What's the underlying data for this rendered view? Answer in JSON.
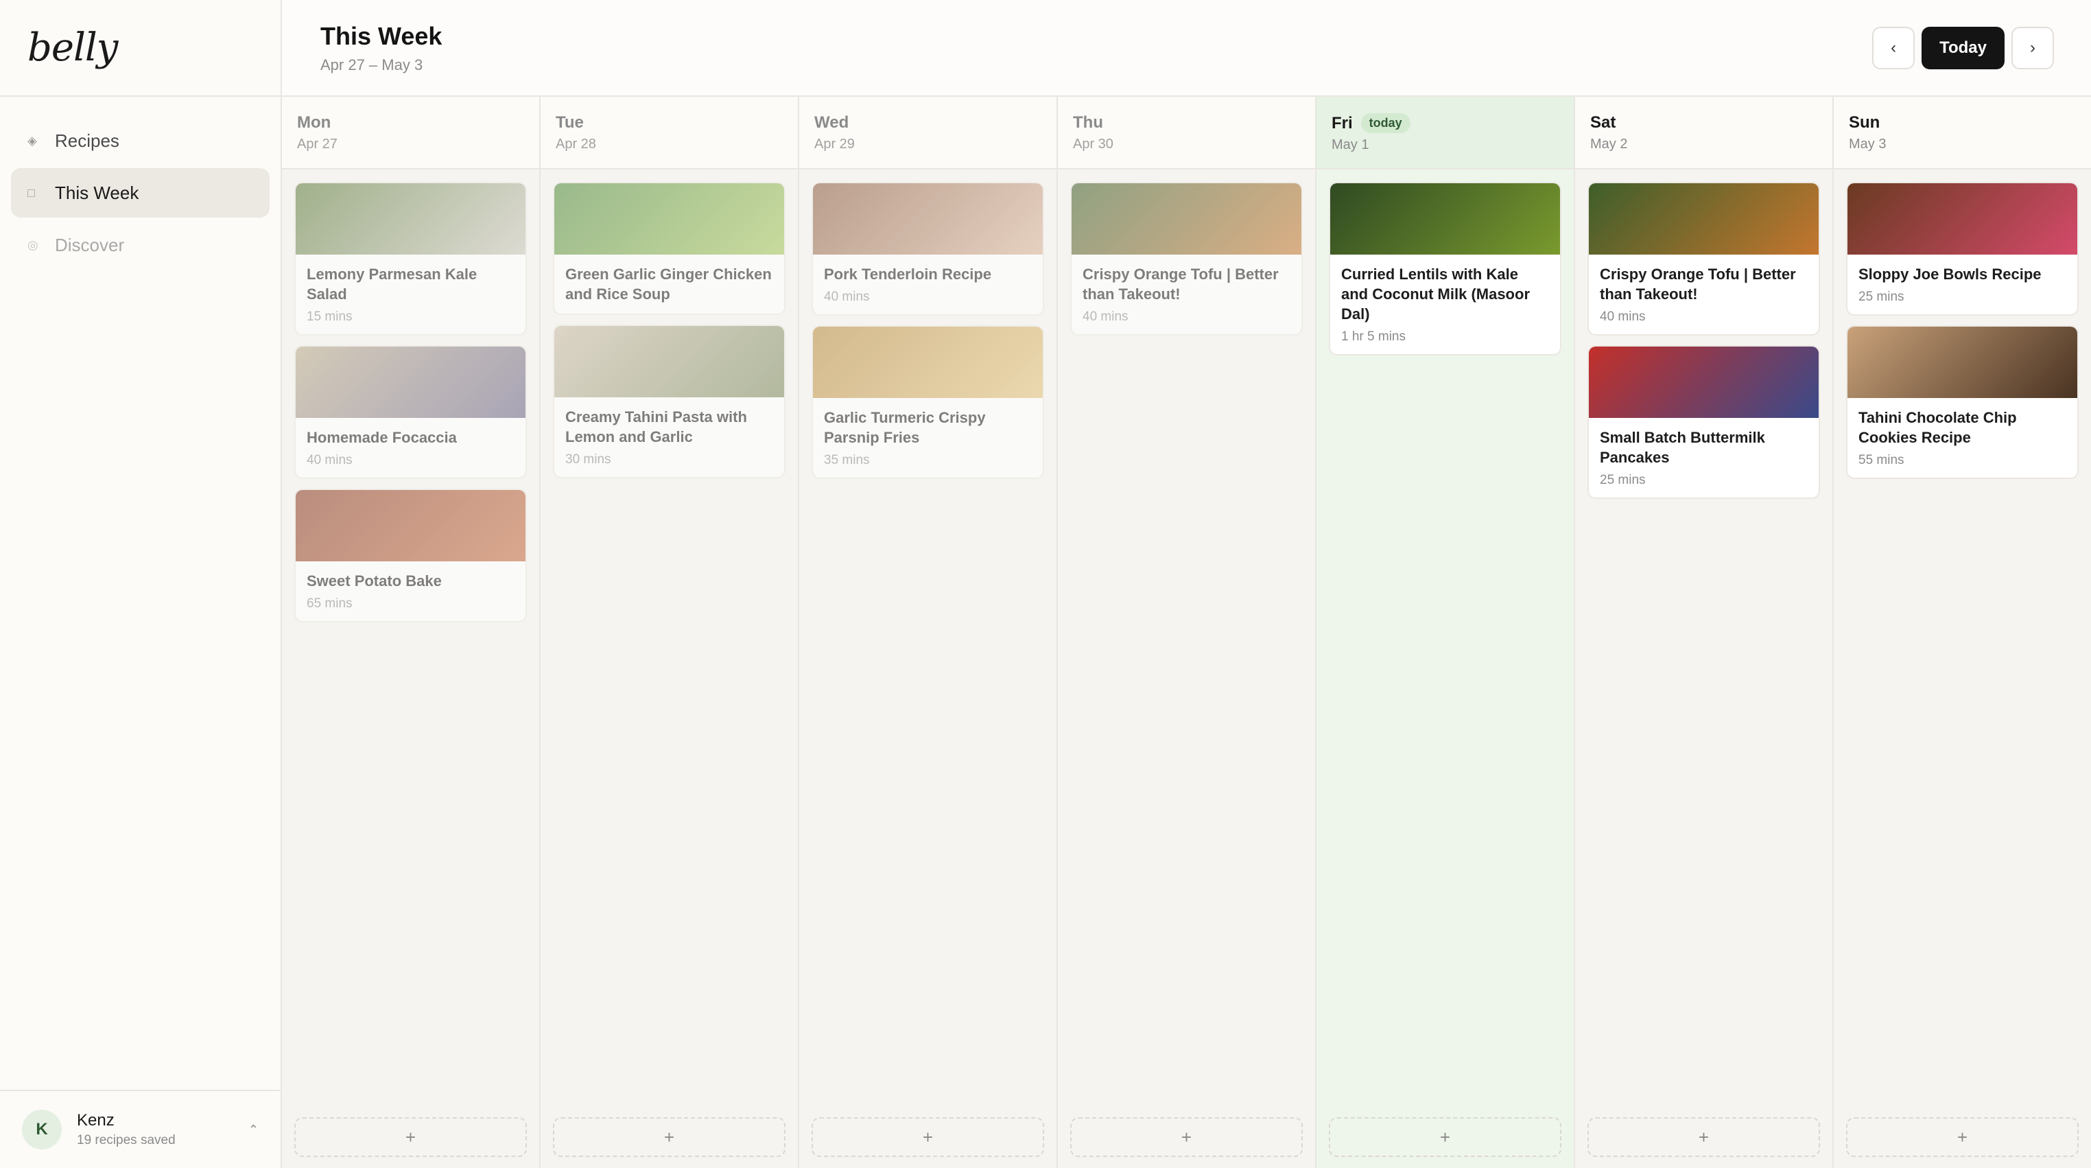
{
  "app": {
    "logo": "belly"
  },
  "sidebar": {
    "items": [
      {
        "label": "Recipes",
        "icon": "diamond-icon",
        "glyph": "◈"
      },
      {
        "label": "This Week",
        "icon": "square-icon",
        "glyph": "□"
      },
      {
        "label": "Discover",
        "icon": "compass-icon",
        "glyph": "◎"
      }
    ],
    "user": {
      "initial": "K",
      "name": "Kenz",
      "subtitle": "19 recipes saved",
      "chevron": "⌃"
    }
  },
  "header": {
    "title": "This Week",
    "range": "Apr 27 – May 3",
    "prev": "‹",
    "today": "Today",
    "next": "›"
  },
  "add_symbol": "+",
  "days": [
    {
      "name": "Mon",
      "date": "Apr 27",
      "meals": [
        {
          "title": "Lemony Parmesan Kale Salad",
          "time": "15 mins",
          "colors": [
            "#5c7a3a",
            "#c9c7bb"
          ]
        },
        {
          "title": "Homemade Focaccia",
          "time": "40 mins",
          "colors": [
            "#b8a98a",
            "#6b6488"
          ]
        },
        {
          "title": "Sweet Potato Bake",
          "time": "65 mins",
          "colors": [
            "#8a3a22",
            "#c46a3e"
          ]
        }
      ]
    },
    {
      "name": "Tue",
      "date": "Apr 28",
      "meals": [
        {
          "title": "Green Garlic Ginger Chicken and Rice Soup",
          "time": "",
          "colors": [
            "#4f8a3a",
            "#a4c65a"
          ]
        },
        {
          "title": "Creamy Tahini Pasta with Lemon and Garlic",
          "time": "30 mins",
          "colors": [
            "#c9bca6",
            "#7c8a5e"
          ]
        }
      ]
    },
    {
      "name": "Wed",
      "date": "Apr 29",
      "meals": [
        {
          "title": "Pork Tenderloin Recipe",
          "time": "40 mins",
          "colors": [
            "#8a5a3e",
            "#d9b49a"
          ]
        },
        {
          "title": "Garlic Turmeric Crispy Parsnip Fries",
          "time": "35 mins",
          "colors": [
            "#b88a3e",
            "#e3c27a"
          ]
        }
      ]
    },
    {
      "name": "Thu",
      "date": "Apr 30",
      "meals": [
        {
          "title": "Crispy Orange Tofu | Better than Takeout!",
          "time": "40 mins",
          "colors": [
            "#3e5e2a",
            "#c4762e"
          ]
        }
      ]
    },
    {
      "name": "Fri",
      "date": "May 1",
      "today_badge": "today",
      "meals": [
        {
          "title": "Curried Lentils with Kale and Coconut Milk (Masoor Dal)",
          "time": "1 hr 5 mins",
          "colors": [
            "#2f4a22",
            "#7a9a2e"
          ]
        }
      ]
    },
    {
      "name": "Sat",
      "date": "May 2",
      "meals": [
        {
          "title": "Crispy Orange Tofu | Better than Takeout!",
          "time": "40 mins",
          "colors": [
            "#3e5e2a",
            "#c4762e"
          ]
        },
        {
          "title": "Small Batch Buttermilk Pancakes",
          "time": "25 mins",
          "colors": [
            "#c2302a",
            "#3a4a8a"
          ]
        }
      ]
    },
    {
      "name": "Sun",
      "date": "May 3",
      "meals": [
        {
          "title": "Sloppy Joe Bowls Recipe",
          "time": "25 mins",
          "colors": [
            "#6a3a22",
            "#d44a6a"
          ]
        },
        {
          "title": "Tahini Chocolate Chip Cookies Recipe",
          "time": "55 mins",
          "colors": [
            "#c9a27a",
            "#4a3322"
          ]
        }
      ]
    }
  ]
}
